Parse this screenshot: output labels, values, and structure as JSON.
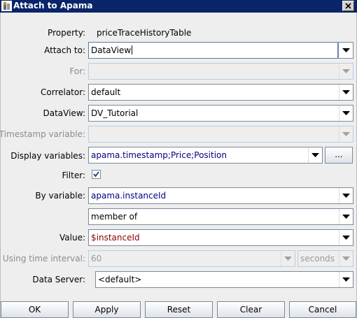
{
  "window": {
    "title": "Attach to Apama"
  },
  "form": {
    "property_label": "Property:",
    "property_value": "priceTraceHistoryTable",
    "attach_to_label": "Attach to:",
    "attach_to_value": "DataView",
    "for_label": "For:",
    "for_value": "",
    "correlator_label": "Correlator:",
    "correlator_value": "default",
    "dataview_label": "DataView:",
    "dataview_value": "DV_Tutorial",
    "timestamp_variable_label": "Timestamp variable:",
    "timestamp_variable_value": "",
    "display_variables_label": "Display variables:",
    "display_variables_value": "apama.timestamp;Price;Position",
    "display_variables_button": "...",
    "filter_label": "Filter:",
    "filter_checked": true,
    "by_variable_label": "By variable:",
    "by_variable_value": "apama.instanceId",
    "operator_value": "member of",
    "value_label": "Value:",
    "value_value": "$instanceId",
    "time_interval_label": "Using time interval:",
    "time_interval_value": "60",
    "time_unit_value": "seconds",
    "data_server_label": "Data Server:",
    "data_server_value": "<default>"
  },
  "buttons": {
    "ok": "OK",
    "apply": "Apply",
    "reset": "Reset",
    "clear": "Clear",
    "cancel": "Cancel"
  },
  "icons": {
    "app": "apama-icon",
    "close": "close-icon",
    "dropdown": "chevron-down-icon",
    "check": "check-icon"
  },
  "colors": {
    "titlebar": "#0a246a",
    "field_text": "#000080",
    "value_text": "#8b0000",
    "disabled_text": "#8c8c8c"
  }
}
